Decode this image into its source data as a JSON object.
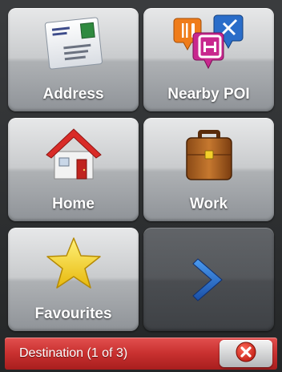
{
  "menu": {
    "tiles": [
      {
        "label": "Address",
        "icon": "envelope-icon"
      },
      {
        "label": "Nearby POI",
        "icon": "poi-pins-icon"
      },
      {
        "label": "Home",
        "icon": "house-icon"
      },
      {
        "label": "Work",
        "icon": "briefcase-icon"
      },
      {
        "label": "Favourites",
        "icon": "star-icon"
      }
    ],
    "next_icon": "chevron-right-icon"
  },
  "statusbar": {
    "title": "Destination (1 of 3)",
    "close_icon": "close-icon"
  },
  "colors": {
    "accent_red": "#c8302f",
    "tile_light": "#c9cbcd",
    "tile_dark": "#55585c",
    "chevron_blue": "#1f5fb8",
    "star_yellow": "#f7d21a"
  }
}
